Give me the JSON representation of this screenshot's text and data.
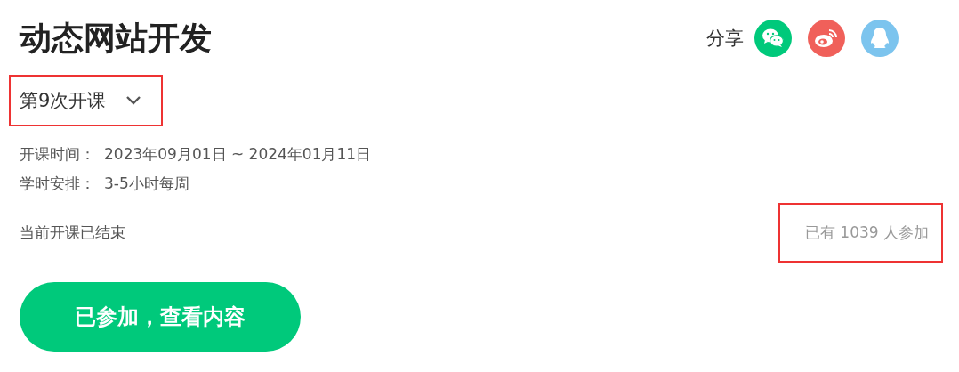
{
  "title": "动态网站开发",
  "share": {
    "label": "分享"
  },
  "session": {
    "label": "第9次开课",
    "highlighted": true
  },
  "info": [
    {
      "label": "开课时间：",
      "value": "2023年09月01日 ~ 2024年01月11日"
    },
    {
      "label": "学时安排：",
      "value": "3-5小时每周"
    }
  ],
  "status": "当前开课已结束",
  "participants": {
    "text": "已有 1039 人参加",
    "highlighted": true
  },
  "action_button": "已参加，查看内容"
}
